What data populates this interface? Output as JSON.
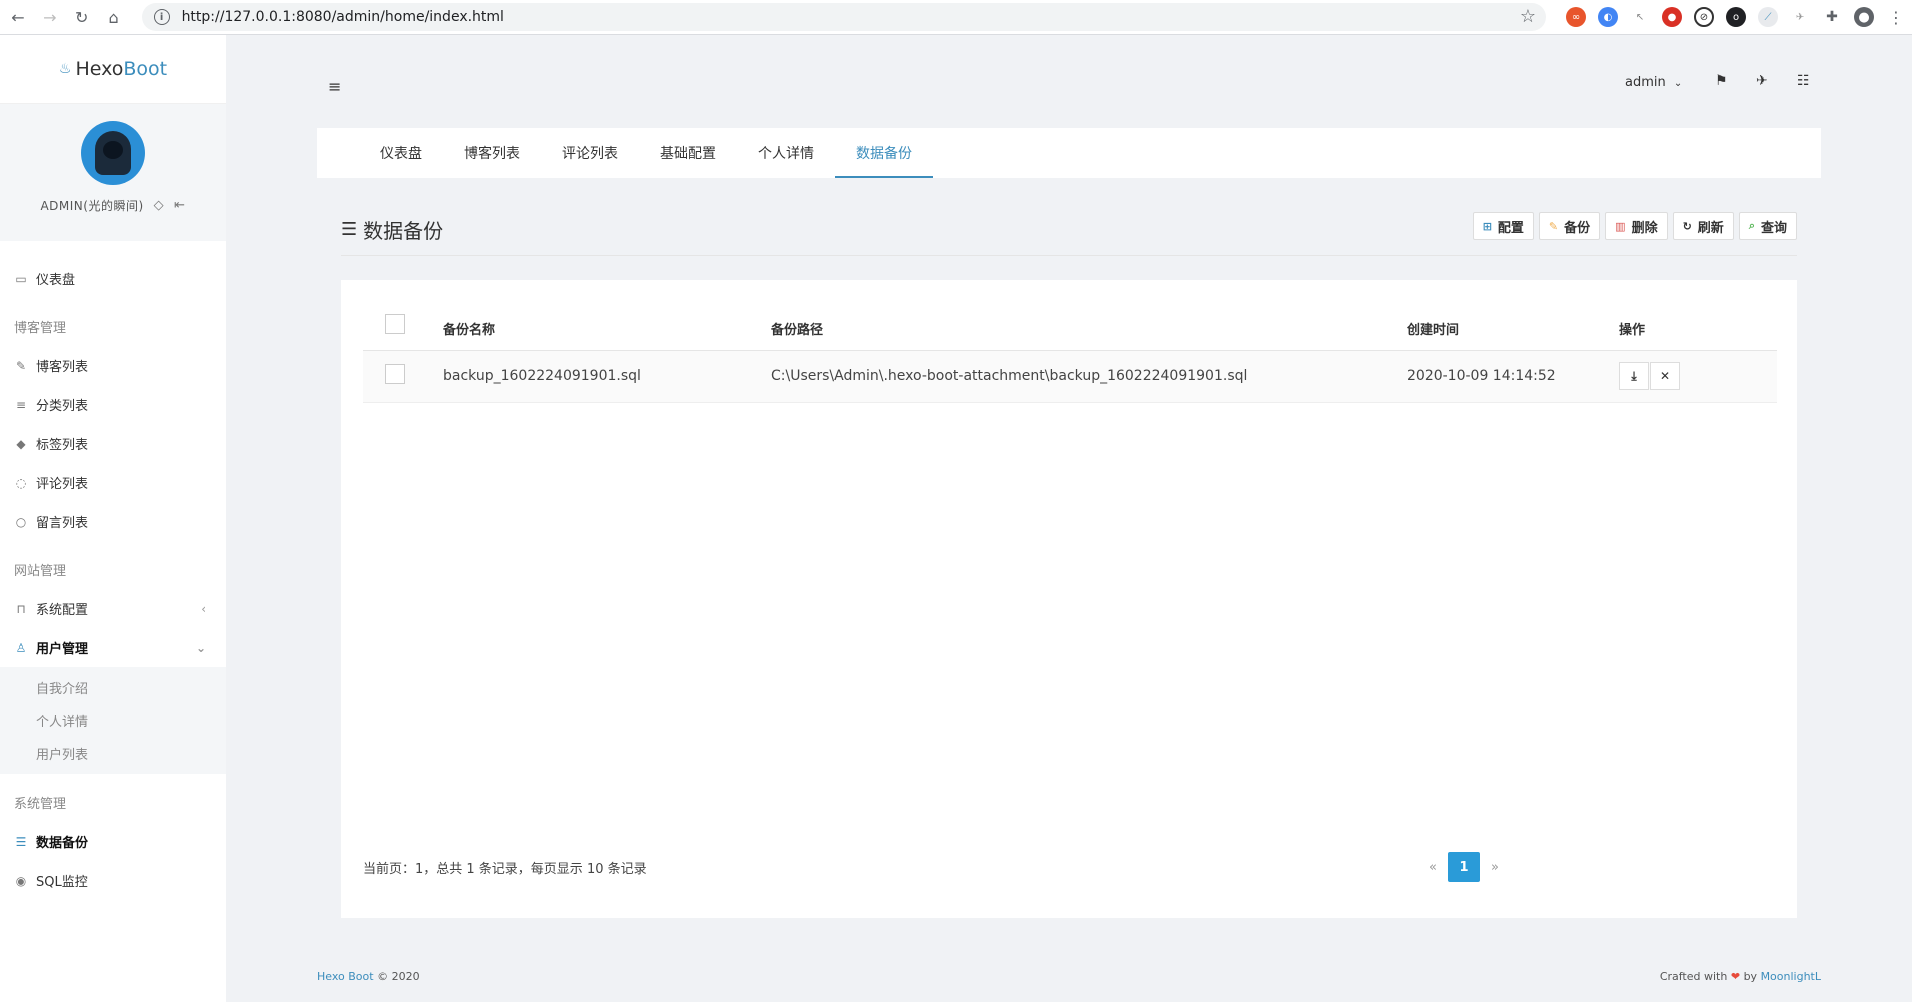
{
  "browser": {
    "url": "http://127.0.0.1:8080/admin/home/index.html"
  },
  "sidebar": {
    "logo_prefix": "Hexo",
    "logo_suffix": "Boot",
    "username": "ADMIN(光的瞬间)",
    "dashboard": "仪表盘",
    "group_blog": "博客管理",
    "blog_items": [
      "博客列表",
      "分类列表",
      "标签列表",
      "评论列表",
      "留言列表"
    ],
    "group_site": "网站管理",
    "system_config": "系统配置",
    "user_mgmt": "用户管理",
    "user_sub": [
      "自我介绍",
      "个人详情",
      "用户列表"
    ],
    "group_sys": "系统管理",
    "data_backup": "数据备份",
    "sql_monitor": "SQL监控"
  },
  "header": {
    "user": "admin"
  },
  "tabs": [
    "仪表盘",
    "博客列表",
    "评论列表",
    "基础配置",
    "个人详情",
    "数据备份"
  ],
  "page": {
    "title": "数据备份",
    "actions": [
      "配置",
      "备份",
      "删除",
      "刷新",
      "查询"
    ]
  },
  "table": {
    "headers": [
      "备份名称",
      "备份路径",
      "创建时间",
      "操作"
    ],
    "rows": [
      {
        "name": "backup_1602224091901.sql",
        "path": "C:\\Users\\Admin\\.hexo-boot-attachment\\backup_1602224091901.sql",
        "time": "2020-10-09 14:14:52"
      }
    ]
  },
  "pagination": {
    "summary": "当前页：1，总共 1 条记录，每页显示 10 条记录",
    "prev": "«",
    "current": "1",
    "next": "»"
  },
  "footer": {
    "brand": "Hexo Boot",
    "copyright": "© 2020",
    "crafted_prefix": "Crafted with",
    "heart": "❤",
    "by": "by",
    "author": "MoonlightL"
  },
  "colors": {
    "accent": "#3c8dbc",
    "pager_active": "#2a9bd8"
  }
}
